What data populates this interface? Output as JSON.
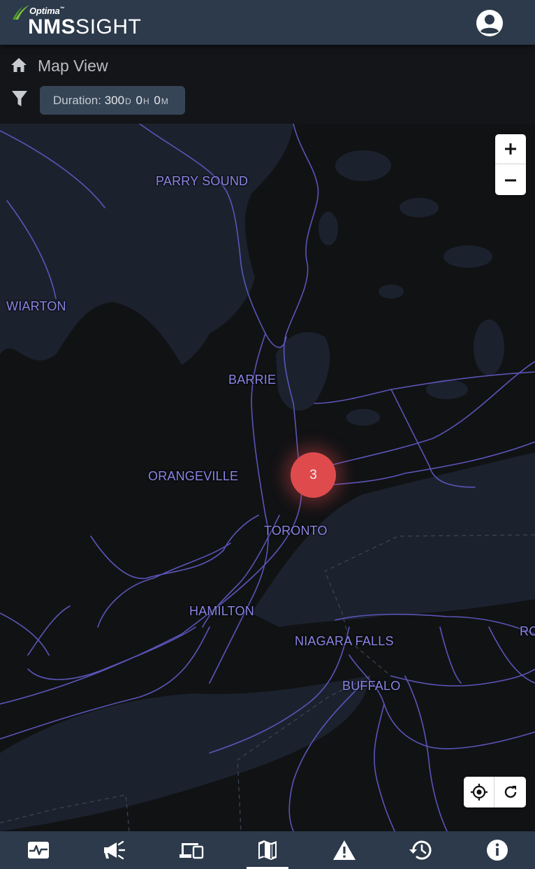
{
  "header": {
    "logo_brand": "Optima",
    "logo_trademark": "™",
    "logo_product_bold": "NMS",
    "logo_product_light": "IGHT",
    "user_icon": "account-circle-icon"
  },
  "subheader": {
    "home_icon": "home-icon",
    "title": "Map View",
    "filter_icon": "filter-icon",
    "duration": {
      "label": "Duration:",
      "days": "300",
      "days_unit": "D",
      "hours": "0",
      "hours_unit": "H",
      "minutes": "0",
      "minutes_unit": "M"
    }
  },
  "map": {
    "cities": [
      {
        "name": "PARRY SOUND"
      },
      {
        "name": "WIARTON"
      },
      {
        "name": "BARRIE"
      },
      {
        "name": "ORANGEVILLE"
      },
      {
        "name": "TORONTO"
      },
      {
        "name": "HAMILTON"
      },
      {
        "name": "NIAGARA FALLS"
      },
      {
        "name": "BUFFALO"
      },
      {
        "name": "RO"
      }
    ],
    "cluster_count": "3",
    "zoom_in_icon": "plus-icon",
    "zoom_out_icon": "minus-icon",
    "locate_icon": "crosshair-icon",
    "refresh_icon": "refresh-icon",
    "colors": {
      "land": "#111214",
      "water": "#1b222e",
      "roads": "#5a55b8",
      "labels": "#8b86e6",
      "cluster": "#df4b4d"
    }
  },
  "bottom_nav": {
    "items": [
      {
        "icon": "activity-pulse-icon",
        "active": false
      },
      {
        "icon": "megaphone-icon",
        "active": false
      },
      {
        "icon": "devices-icon",
        "active": false
      },
      {
        "icon": "map-icon",
        "active": true
      },
      {
        "icon": "warning-icon",
        "active": false
      },
      {
        "icon": "history-icon",
        "active": false
      },
      {
        "icon": "info-icon",
        "active": false
      }
    ]
  }
}
